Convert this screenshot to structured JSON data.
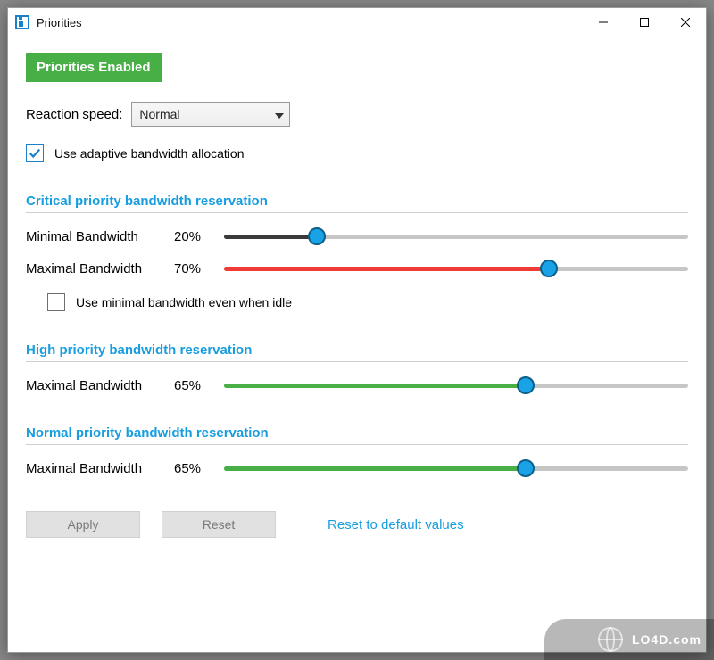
{
  "window": {
    "title": "Priorities"
  },
  "badge": {
    "text": "Priorities Enabled",
    "bg": "#47af45"
  },
  "reaction": {
    "label": "Reaction speed:",
    "value": "Normal"
  },
  "adaptive": {
    "checked": true,
    "label": "Use adaptive bandwidth allocation"
  },
  "sections": {
    "critical": {
      "title": "Critical priority bandwidth reservation",
      "min": {
        "label": "Minimal Bandwidth",
        "value": 20,
        "display": "20%",
        "fill": "fill-dark"
      },
      "max": {
        "label": "Maximal Bandwidth",
        "value": 70,
        "display": "70%",
        "fill": "fill-red"
      },
      "idle": {
        "checked": false,
        "label": "Use minimal bandwidth even when idle"
      }
    },
    "high": {
      "title": "High priority bandwidth reservation",
      "max": {
        "label": "Maximal Bandwidth",
        "value": 65,
        "display": "65%",
        "fill": "fill-green"
      }
    },
    "normal": {
      "title": "Normal priority bandwidth reservation",
      "max": {
        "label": "Maximal Bandwidth",
        "value": 65,
        "display": "65%",
        "fill": "fill-green"
      }
    }
  },
  "buttons": {
    "apply": "Apply",
    "reset": "Reset",
    "default_link": "Reset to default values"
  },
  "watermark": "LO4D.com"
}
